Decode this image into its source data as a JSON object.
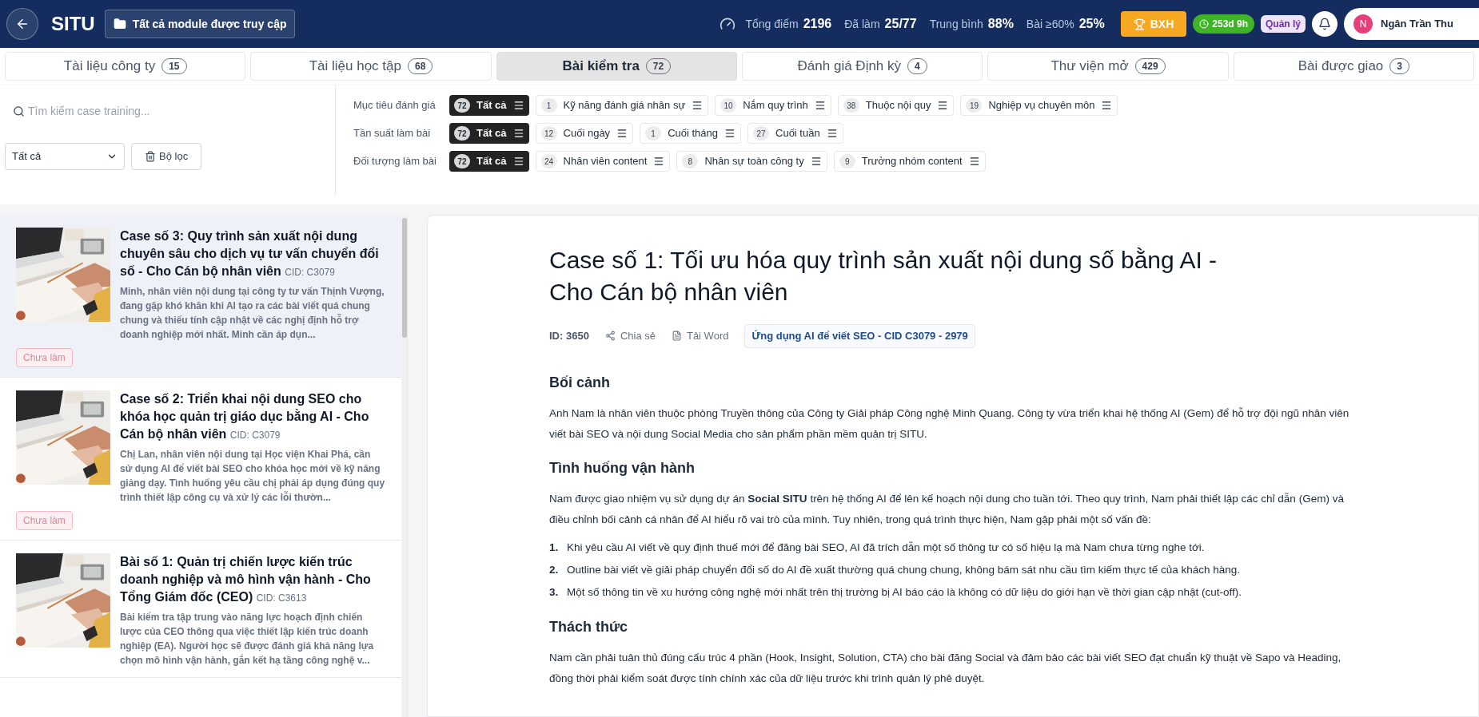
{
  "header": {
    "app_name": "SITU",
    "module_button": "Tất cả module được truy cập",
    "stats": [
      {
        "label": "Tổng điểm",
        "value": "2196"
      },
      {
        "label": "Đã làm",
        "value": "25/77"
      },
      {
        "label": "Trung bình",
        "value": "88%"
      },
      {
        "label": "Bài ≥60%",
        "value": "25%"
      }
    ],
    "ranking_button": "BXH",
    "timer": "253d 9h",
    "role_badge": "Quản lý",
    "user": {
      "initial": "N",
      "name": "Ngân Trần Thu"
    }
  },
  "tabs": [
    {
      "label": "Tài liệu công ty",
      "count": "15",
      "selected": false
    },
    {
      "label": "Tài liệu học tập",
      "count": "68",
      "selected": false
    },
    {
      "label": "Bài kiểm tra",
      "count": "72",
      "selected": true
    },
    {
      "label": "Đánh giá Định kỳ",
      "count": "4",
      "selected": false
    },
    {
      "label": "Thư viện mở",
      "count": "429",
      "selected": false
    },
    {
      "label": "Bài được giao",
      "count": "3",
      "selected": false
    }
  ],
  "search": {
    "placeholder": "Tìm kiếm case training..."
  },
  "status_select": {
    "value": "Tất cả"
  },
  "filter_button": "Bộ lọc",
  "filter_groups": [
    {
      "label": "Mục tiêu đánh giá",
      "options": [
        {
          "count": "72",
          "label": "Tất cả",
          "selected": true
        },
        {
          "count": "1",
          "label": "Kỹ năng đánh giá nhân sự",
          "selected": false
        },
        {
          "count": "10",
          "label": "Nắm quy trình",
          "selected": false
        },
        {
          "count": "38",
          "label": "Thuộc nội quy",
          "selected": false
        },
        {
          "count": "19",
          "label": "Nghiệp vụ chuyên môn",
          "selected": false
        }
      ]
    },
    {
      "label": "Tần suất làm bài",
      "options": [
        {
          "count": "72",
          "label": "Tất cả",
          "selected": true
        },
        {
          "count": "12",
          "label": "Cuối ngày",
          "selected": false
        },
        {
          "count": "1",
          "label": "Cuối tháng",
          "selected": false
        },
        {
          "count": "27",
          "label": "Cuối tuần",
          "selected": false
        }
      ]
    },
    {
      "label": "Đối tượng làm bài",
      "options": [
        {
          "count": "72",
          "label": "Tất cả",
          "selected": true
        },
        {
          "count": "24",
          "label": "Nhân viên content",
          "selected": false
        },
        {
          "count": "8",
          "label": "Nhân sự toàn công ty",
          "selected": false
        },
        {
          "count": "9",
          "label": "Trưởng nhóm content",
          "selected": false
        }
      ]
    }
  ],
  "cases": [
    {
      "title": "Case số 3: Quy trình sản xuất nội dung chuyên sâu cho dịch vụ tư vấn chuyển đổi số - Cho Cán bộ nhân viên",
      "cid": "CID: C3079",
      "description": "Minh, nhân viên nội dung tại công ty tư vấn Thịnh Vượng, đang gặp khó khăn khi AI tạo ra các bài viết quá chung chung và thiếu tính cập nhật về các nghị định hỗ trợ doanh nghiệp mới nhất. Minh cần áp dụn...",
      "status": "Chưa làm",
      "selected": true
    },
    {
      "title": "Case số 2: Triển khai nội dung SEO cho khóa học quản trị giáo dục bằng AI - Cho Cán bộ nhân viên",
      "cid": "CID: C3079",
      "description": "Chị Lan, nhân viên nội dung tại Học viện Khai Phá, cần sử dụng AI để viết bài SEO cho khóa học mới về kỹ năng giảng dạy. Tình huống yêu cầu chị phải áp dụng đúng quy trình thiết lập công cụ và xử lý các lỗi thườn...",
      "status": "Chưa làm",
      "selected": false
    },
    {
      "title": "Bài số 1: Quản trị chiến lược kiến trúc doanh nghiệp và mô hình vận hành - Cho Tổng Giám đốc (CEO)",
      "cid": "CID: C3613",
      "description": "Bài kiểm tra tập trung vào năng lực hoạch định chiến lược của CEO thông qua việc thiết lập kiến trúc doanh nghiệp (EA). Người học sẽ được đánh giá khả năng lựa chọn mô hình vận hành, gắn kết hạ tầng công nghệ v...",
      "selected": false
    }
  ],
  "detail": {
    "title": "Case số 1: Tối ưu hóa quy trình sản xuất nội dung số bằng AI - Cho Cán bộ nhân viên",
    "id": "ID: 3650",
    "share": "Chia sẻ",
    "download": "Tải Word",
    "tag": "Ứng dụng AI để viết SEO - CID C3079 - 2979",
    "sections": [
      {
        "heading": "Bối cảnh",
        "blocks": [
          {
            "kind": "paragraph",
            "text": "Anh Nam là nhân viên thuộc phòng Truyền thông của Công ty Giải pháp Công nghệ Minh Quang. Công ty vừa triển khai hệ thống AI (Gem) để hỗ trợ đội ngũ nhân viên viết bài SEO và nội dung Social Media cho sản phẩm phần mềm quản trị SITU."
          }
        ]
      },
      {
        "heading": "Tình huống vận hành",
        "blocks": [
          {
            "kind": "paragraph",
            "text": "Nam được giao nhiệm vụ sử dụng dự án **Social SITU** trên hệ thống AI để lên kế hoạch nội dung cho tuần tới. Theo quy trình, Nam phải thiết lập các chỉ dẫn (Gem) và điều chỉnh bối cảnh cá nhân để AI hiểu rõ vai trò của mình. Tuy nhiên, trong quá trình thực hiện, Nam gặp phải một số vấn đề:"
          },
          {
            "kind": "ordered_list",
            "items": [
              {
                "marker": "1.",
                "text": "Khi yêu cầu AI viết về quy định thuế mới để đăng bài SEO, AI đã trích dẫn một số thông tư có số hiệu lạ mà Nam chưa từng nghe tới."
              },
              {
                "marker": "2.",
                "text": "Outline bài viết về giải pháp chuyển đổi số do AI đề xuất thường quá chung chung, không bám sát nhu cầu tìm kiếm thực tế của khách hàng."
              },
              {
                "marker": "3.",
                "text": "Một số thông tin về xu hướng công nghệ mới nhất trên thị trường bị AI báo cáo là không có dữ liệu do giới hạn về thời gian cập nhật (cut-off)."
              }
            ]
          }
        ]
      },
      {
        "heading": "Thách thức",
        "blocks": [
          {
            "kind": "paragraph",
            "text": "Nam cần phải tuân thủ đúng cấu trúc 4 phần (Hook, Insight, Solution, CTA) cho bài đăng Social và đảm bảo các bài viết SEO đạt chuẩn kỹ thuật về Sapo và Heading, đồng thời phải kiểm soát được tính chính xác của dữ liệu trước khi trình quản lý phê duyệt."
          }
        ]
      }
    ]
  }
}
